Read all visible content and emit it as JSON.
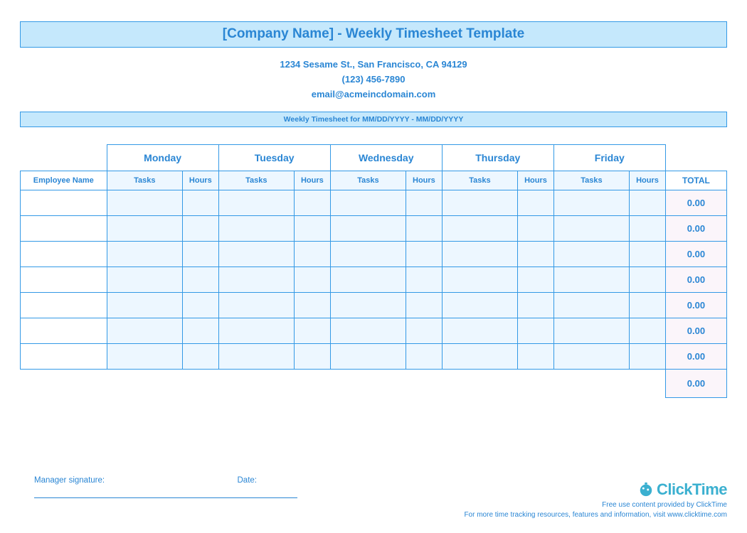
{
  "header": {
    "title": "[Company Name] - Weekly Timesheet Template",
    "address": "1234 Sesame St.,  San Francisco, CA 94129",
    "phone": "(123) 456-7890",
    "email": "email@acmeincdomain.com",
    "period_bar": "Weekly Timesheet for MM/DD/YYYY - MM/DD/YYYY"
  },
  "table": {
    "employee_header": "Employee Name",
    "days": [
      "Monday",
      "Tuesday",
      "Wednesday",
      "Thursday",
      "Friday"
    ],
    "sub_tasks": "Tasks",
    "sub_hours": "Hours",
    "total_header": "TOTAL",
    "rows": [
      {
        "total": "0.00"
      },
      {
        "total": "0.00"
      },
      {
        "total": "0.00"
      },
      {
        "total": "0.00"
      },
      {
        "total": "0.00"
      },
      {
        "total": "0.00"
      },
      {
        "total": "0.00"
      }
    ],
    "grand_total": "0.00"
  },
  "signature": {
    "manager_label": "Manager signature:",
    "date_label": "Date:"
  },
  "footer": {
    "logo_text": "ClickTime",
    "line1": "Free use content provided by ClickTime",
    "line2": "For more time tracking resources, features and information, visit www.clicktime.com"
  }
}
